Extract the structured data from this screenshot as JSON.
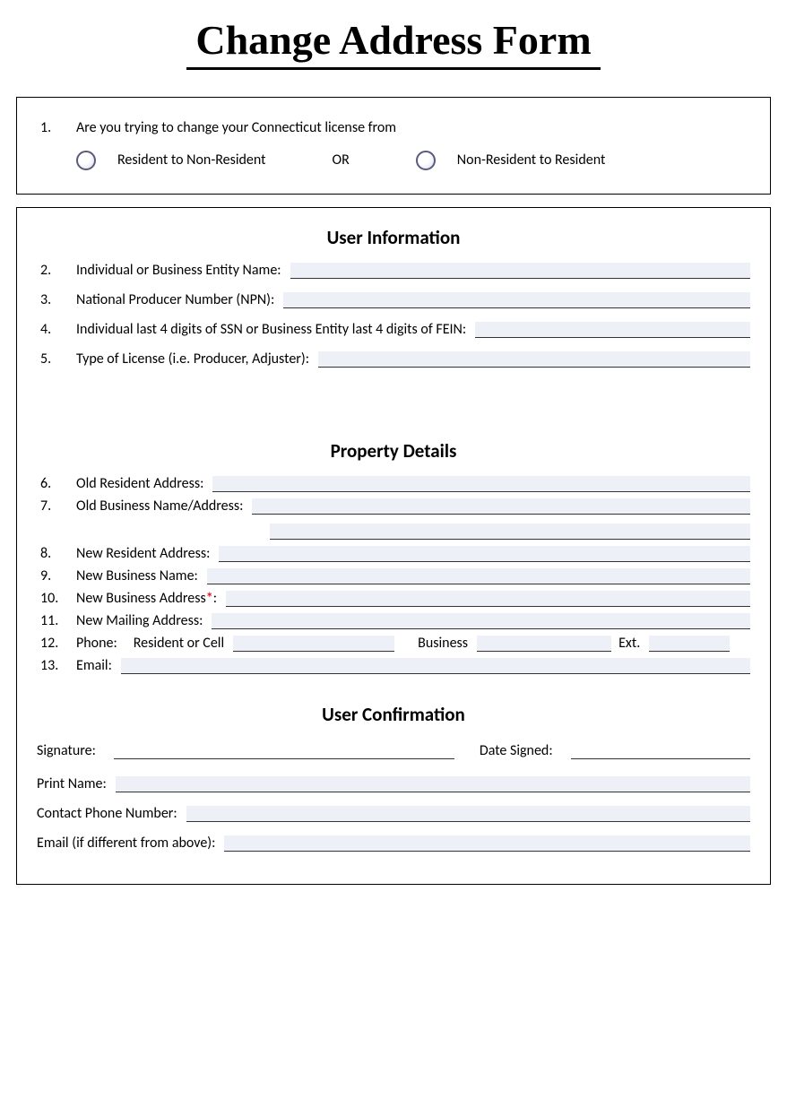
{
  "title": "Change Address Form",
  "q1": {
    "num": "1.",
    "text": "Are you trying to change your Connecticut license from",
    "optA": "Resident to Non-Resident",
    "or": "OR",
    "optB": "Non-Resident to Resident"
  },
  "userInfoHeader": "User Information",
  "q2": {
    "num": "2.",
    "label": "Individual or Business Entity Name:"
  },
  "q3": {
    "num": "3.",
    "label": "National Producer Number (NPN):"
  },
  "q4": {
    "num": "4.",
    "label": "Individual last 4 digits of SSN or Business Entity last 4 digits of FEIN:"
  },
  "q5": {
    "num": "5.",
    "label": "Type of License (i.e. Producer, Adjuster):"
  },
  "propHeader": "Property Details",
  "q6": {
    "num": "6.",
    "label": "Old Resident Address:"
  },
  "q7": {
    "num": "7.",
    "label": "Old Business Name/Address:"
  },
  "q8": {
    "num": "8.",
    "label": "New Resident Address:"
  },
  "q9": {
    "num": "9.",
    "label": "New Business Name:"
  },
  "q10": {
    "num": "10.",
    "label_pre": "New Business Address",
    "label_post": ":"
  },
  "q11": {
    "num": "11.",
    "label": "New Mailing Address:"
  },
  "q12": {
    "num": "12.",
    "label": "Phone:",
    "sub1": "Resident or Cell",
    "sub2": "Business",
    "sub3": "Ext."
  },
  "q13": {
    "num": "13.",
    "label": "Email:"
  },
  "confirmHeader": "User Confirmation",
  "sig": {
    "label": "Signature:",
    "date": "Date Signed:"
  },
  "printName": "Print Name:",
  "contactPhone": "Contact Phone Number:",
  "emailDiff": "Email (if different from above):"
}
